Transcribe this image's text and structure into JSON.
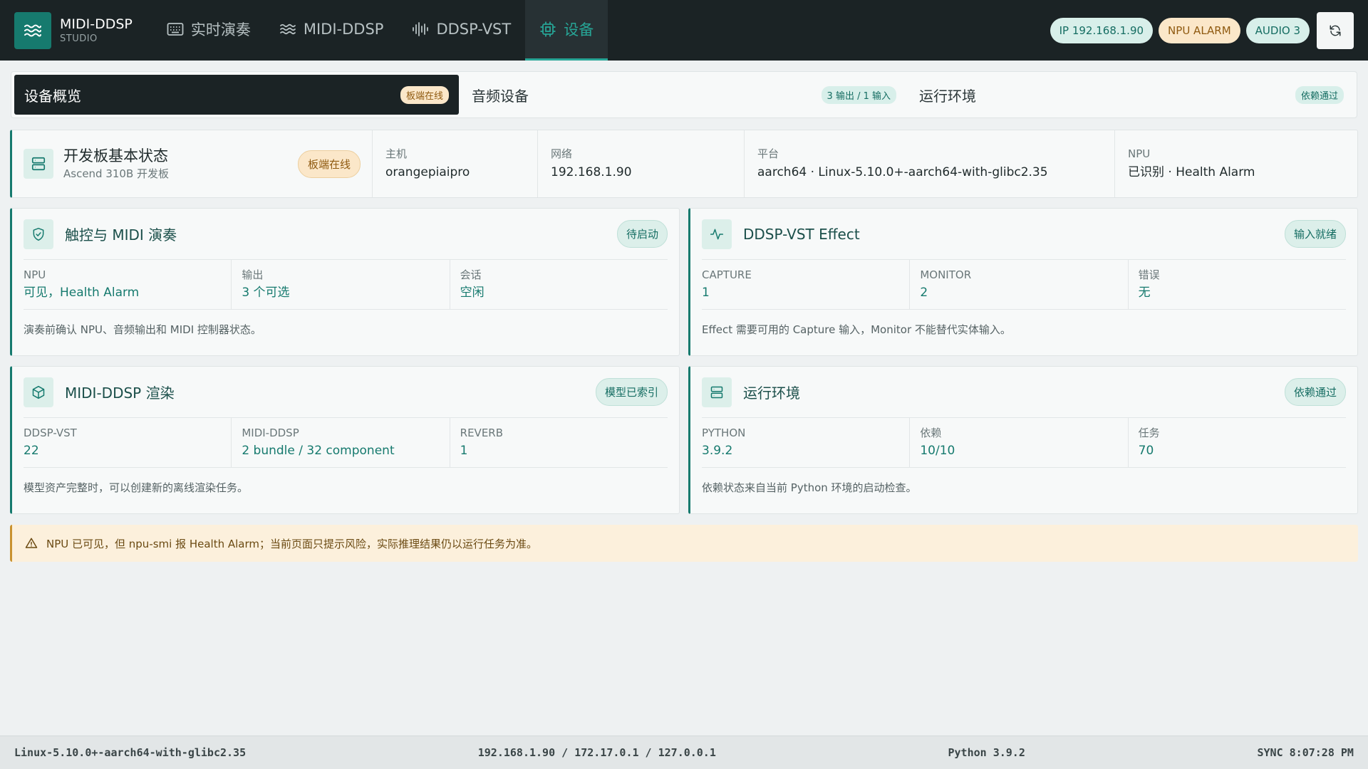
{
  "brand": {
    "name": "MIDI-DDSP",
    "sub": "STUDIO",
    "icon": "waves-icon"
  },
  "nav": {
    "tabs": [
      {
        "label": "实时演奏",
        "icon": "keyboard-icon"
      },
      {
        "label": "MIDI-DDSP",
        "icon": "waves-icon"
      },
      {
        "label": "DDSP-VST",
        "icon": "audio-lines-icon"
      },
      {
        "label": "设备",
        "icon": "chip-icon",
        "active": true
      }
    ]
  },
  "header_pills": {
    "ip": "IP 192.168.1.90",
    "npu": "NPU ALARM",
    "audio": "AUDIO 3"
  },
  "section_tabs": [
    {
      "label": "设备概览",
      "badge": "板端在线",
      "active": true
    },
    {
      "label": "音频设备",
      "badge": "3 输出 / 1 输入"
    },
    {
      "label": "运行环境",
      "badge": "依赖通过"
    }
  ],
  "board_status": {
    "title": "开发板基本状态",
    "subtitle": "Ascend 310B 开发板",
    "badge": "板端在线",
    "cells": [
      {
        "label": "主机",
        "value": "orangepiaipro"
      },
      {
        "label": "网络",
        "value": "192.168.1.90"
      },
      {
        "label": "平台",
        "value": "aarch64 · Linux-5.10.0+-aarch64-with-glibc2.35"
      },
      {
        "label": "NPU",
        "value": "已识别 · Health Alarm"
      }
    ]
  },
  "cards": {
    "touch": {
      "title": "触控与 MIDI 演奏",
      "badge": "待启动",
      "metrics": [
        {
          "label": "NPU",
          "value": "可见，Health Alarm"
        },
        {
          "label": "输出",
          "value": "3 个可选"
        },
        {
          "label": "会话",
          "value": "空闲"
        }
      ],
      "note": "演奏前确认 NPU、音频输出和 MIDI 控制器状态。"
    },
    "vst": {
      "title": "DDSP-VST Effect",
      "badge": "输入就绪",
      "metrics": [
        {
          "label": "CAPTURE",
          "value": "1"
        },
        {
          "label": "MONITOR",
          "value": "2"
        },
        {
          "label": "错误",
          "value": "无"
        }
      ],
      "note": "Effect 需要可用的 Capture 输入，Monitor 不能替代实体输入。"
    },
    "render": {
      "title": "MIDI-DDSP 渲染",
      "badge": "模型已索引",
      "metrics": [
        {
          "label": "DDSP-VST",
          "value": "22"
        },
        {
          "label": "MIDI-DDSP",
          "value": "2 bundle / 32 component"
        },
        {
          "label": "REVERB",
          "value": "1"
        }
      ],
      "note": "模型资产完整时，可以创建新的离线渲染任务。"
    },
    "env": {
      "title": "运行环境",
      "badge": "依赖通过",
      "metrics": [
        {
          "label": "PYTHON",
          "value": "3.9.2"
        },
        {
          "label": "依赖",
          "value": "10/10"
        },
        {
          "label": "任务",
          "value": "70"
        }
      ],
      "note": "依赖状态来自当前 Python 环境的启动检查。"
    }
  },
  "alert": {
    "text": "NPU 已可见，但 npu-smi 报 Health Alarm；当前页面只提示风险，实际推理结果仍以运行任务为准。"
  },
  "footer": {
    "platform": "Linux-5.10.0+-aarch64-with-glibc2.35",
    "addresses": "192.168.1.90 / 172.17.0.1 / 127.0.0.1",
    "python": "Python 3.9.2",
    "sync": "SYNC 8:07:28 PM"
  },
  "colors": {
    "accent": "#167a6e",
    "dark": "#1b2325",
    "warning": "#fbe7c9",
    "background": "#eef1f2"
  }
}
